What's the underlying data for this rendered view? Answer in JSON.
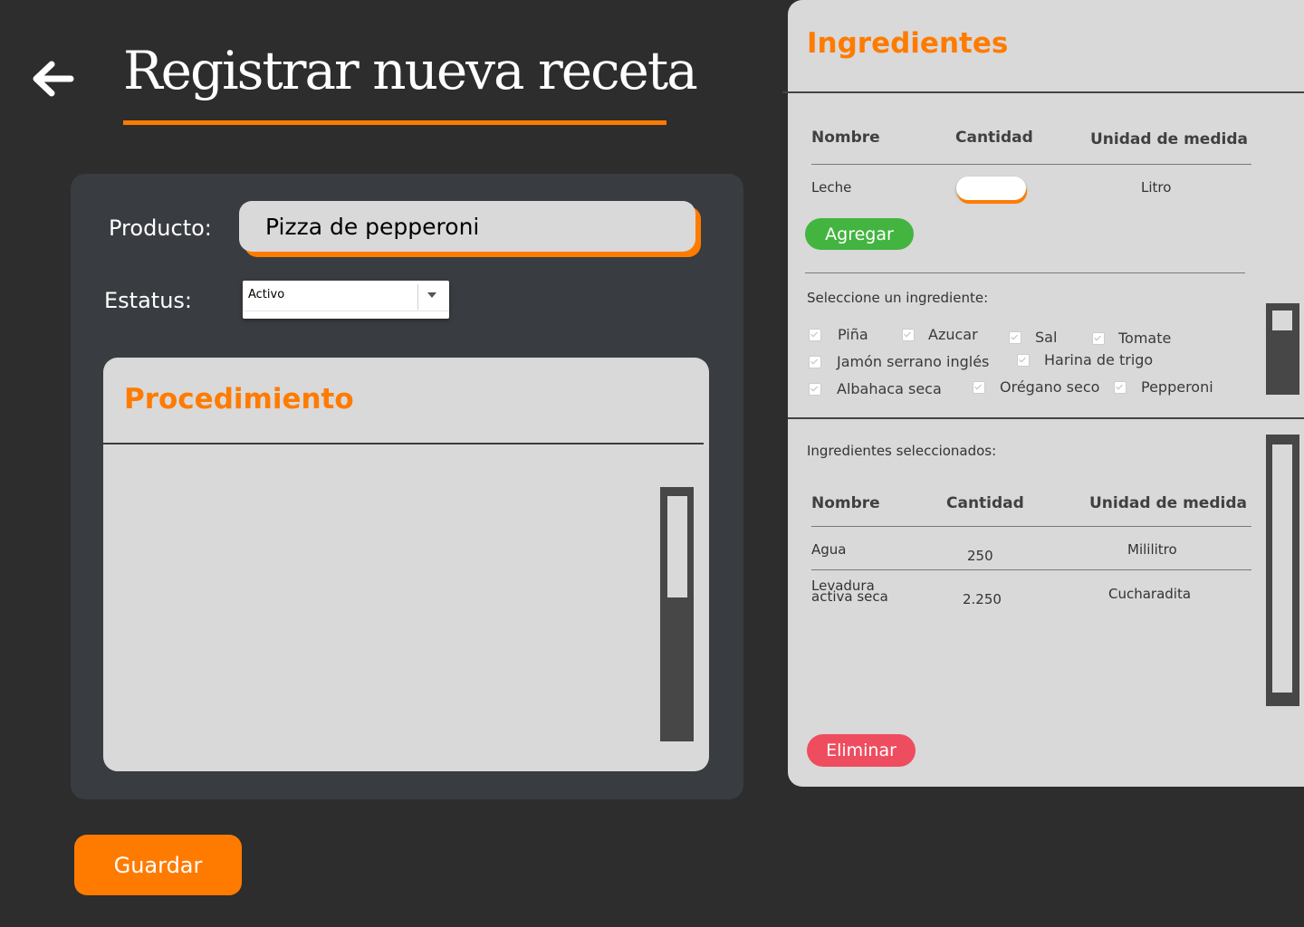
{
  "header": {
    "back_icon": "arrow-left-icon",
    "title": "Registrar nueva receta",
    "accent_color": "#ff7b00"
  },
  "form": {
    "producto_label": "Producto:",
    "producto_value": "Pizza de pepperoni",
    "estatus_label": "Estatus:",
    "estatus_value": "Activo",
    "procedimiento_title": "Procedimiento",
    "procedimiento_value": ""
  },
  "actions": {
    "guardar_label": "Guardar"
  },
  "ingredients": {
    "title": "Ingredientes",
    "columns": [
      "Nombre",
      "Cantidad",
      "Unidad de medida"
    ],
    "add_row": {
      "nombre": "Leche",
      "cantidad": "",
      "unidad": "Litro"
    },
    "agregar_label": "Agregar",
    "agregar_color": "#44b441",
    "select_caption": "Seleccione un ingrediente:",
    "options": [
      "Piña",
      "Azucar",
      "Sal",
      "Tomate",
      "Jamón serrano inglés",
      "Harina de trigo",
      "Albahaca seca",
      "Orégano seco",
      "Pepperoni"
    ],
    "selected_caption": "Ingredientes seleccionados:",
    "selected_rows": [
      {
        "nombre": "Agua",
        "cantidad": "250",
        "unidad": "Mililitro"
      },
      {
        "nombre": "Levadura activa seca",
        "cantidad": "2.250",
        "unidad": "Cucharadita"
      }
    ],
    "eliminar_label": "Eliminar",
    "eliminar_color": "#ee4d5f"
  }
}
